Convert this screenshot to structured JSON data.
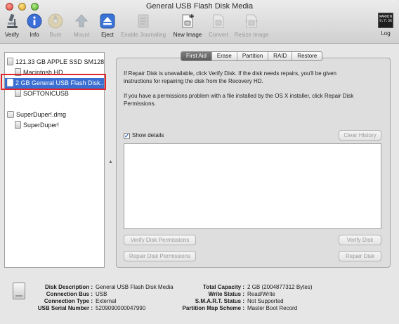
{
  "window": {
    "title": "General USB Flash Disk Media"
  },
  "toolbar": {
    "items": [
      {
        "label": "Verify",
        "icon": "microscope-icon",
        "enabled": true
      },
      {
        "label": "Info",
        "icon": "info-icon",
        "enabled": true
      },
      {
        "label": "Burn",
        "icon": "burn-icon",
        "enabled": false
      },
      {
        "label": "Mount",
        "icon": "mount-icon",
        "enabled": false
      },
      {
        "label": "Eject",
        "icon": "eject-icon",
        "enabled": true
      },
      {
        "label": "Enable Journaling",
        "icon": "journaling-icon",
        "enabled": false
      },
      {
        "label": "New Image",
        "icon": "new-image-icon",
        "enabled": true
      },
      {
        "label": "Convert",
        "icon": "convert-icon",
        "enabled": false
      },
      {
        "label": "Resize Image",
        "icon": "resize-image-icon",
        "enabled": false
      },
      {
        "label": "Log",
        "icon": "log-icon",
        "enabled": true
      }
    ],
    "log_icon_text": [
      "WARNIN",
      "9:7:36"
    ]
  },
  "sidebar": {
    "items": [
      {
        "label": "121.33 GB APPLE SSD SM128..."
      },
      {
        "label": "Macintosh HD"
      },
      {
        "label": "2 GB General USB Flash Disk..."
      },
      {
        "label": "SOFTONICUSB"
      },
      {
        "label": "SuperDuper!.dmg"
      },
      {
        "label": "SuperDuper!"
      }
    ]
  },
  "tabs": [
    "First Aid",
    "Erase",
    "Partition",
    "RAID",
    "Restore"
  ],
  "first_aid": {
    "help_line1": "If Repair Disk is unavailable, click Verify Disk. If the disk needs repairs, you'll be given",
    "help_line2": "instructions for repairing the disk from the Recovery HD.",
    "help_line3": "If you have a permissions problem with a file installed by the OS X installer, click Repair Disk",
    "help_line4": "Permissions.",
    "show_details_label": "Show details",
    "show_details_checked": true,
    "clear_history": "Clear History",
    "verify_permissions": "Verify Disk Permissions",
    "repair_permissions": "Repair Disk Permissions",
    "verify_disk": "Verify Disk",
    "repair_disk": "Repair Disk"
  },
  "disk_info": {
    "left": [
      {
        "label": "Disk Description :",
        "value": "General USB Flash Disk Media"
      },
      {
        "label": "Connection Bus :",
        "value": "USB"
      },
      {
        "label": "Connection Type :",
        "value": "External"
      },
      {
        "label": "USB Serial Number :",
        "value": "5209090000047990"
      }
    ],
    "right": [
      {
        "label": "Total Capacity :",
        "value": "2 GB (2004877312 Bytes)"
      },
      {
        "label": "Write Status :",
        "value": "Read/Write"
      },
      {
        "label": "S.M.A.R.T. Status :",
        "value": "Not Supported"
      },
      {
        "label": "Partition Map Scheme :",
        "value": "Master Boot Record"
      }
    ]
  },
  "colors": {
    "selection": "#3a6fd1",
    "highlight_border": "#e2252c",
    "active_tab": "#6a6a6a"
  }
}
